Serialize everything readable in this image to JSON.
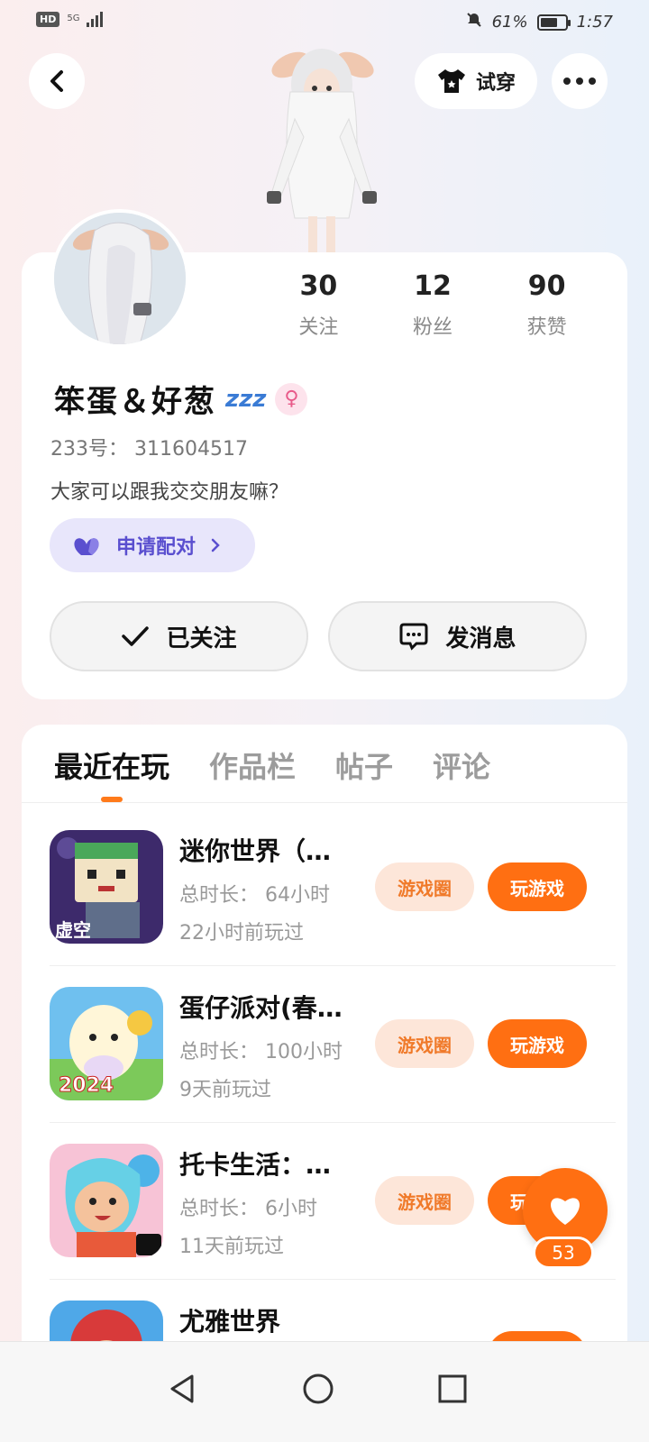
{
  "status_bar": {
    "hd": "HD",
    "network": "5G",
    "battery_percent": "61%",
    "battery_level": 0.61,
    "time": "1:57"
  },
  "header": {
    "tryon_label": "试穿"
  },
  "profile": {
    "stats": [
      {
        "value": "30",
        "label": "关注"
      },
      {
        "value": "12",
        "label": "粉丝"
      },
      {
        "value": "90",
        "label": "获赞"
      }
    ],
    "username": "笨蛋＆好葱",
    "status_emoji": "zzz",
    "gender_symbol": "♀",
    "uid": "233号： 311604517",
    "bio": "大家可以跟我交交朋友嘛？",
    "pair_label": "申请配对",
    "follow_label": "已关注",
    "message_label": "发消息"
  },
  "tabs": [
    {
      "label": "最近在玩",
      "active": true
    },
    {
      "label": "作品栏",
      "active": false
    },
    {
      "label": "帖子",
      "active": false
    },
    {
      "label": "评论",
      "active": false
    }
  ],
  "games": [
    {
      "title": "迷你世界（…",
      "duration": "总时长： 64小时",
      "last_played": "22小时前玩过",
      "circle_label": "游戏圈",
      "play_label": "玩游戏",
      "icon_badge": "虚空"
    },
    {
      "title": "蛋仔派对(春…",
      "duration": "总时长： 100小时",
      "last_played": "9天前玩过",
      "circle_label": "游戏圈",
      "play_label": "玩游戏",
      "icon_badge": "2024"
    },
    {
      "title": "托卡生活：…",
      "duration": "总时长： 6小时",
      "last_played": "11天前玩过",
      "circle_label": "游戏圈",
      "play_label": "玩游戏",
      "icon_badge": ""
    },
    {
      "title": "尤雅世界",
      "duration": "",
      "last_played": "",
      "circle_label": "",
      "play_label": "",
      "icon_badge": ""
    }
  ],
  "fab": {
    "like_count": "53"
  },
  "colors": {
    "accent_orange": "#ff6f12",
    "pair_purple": "#5a4fcf",
    "circle_bg": "#fde6d9"
  }
}
